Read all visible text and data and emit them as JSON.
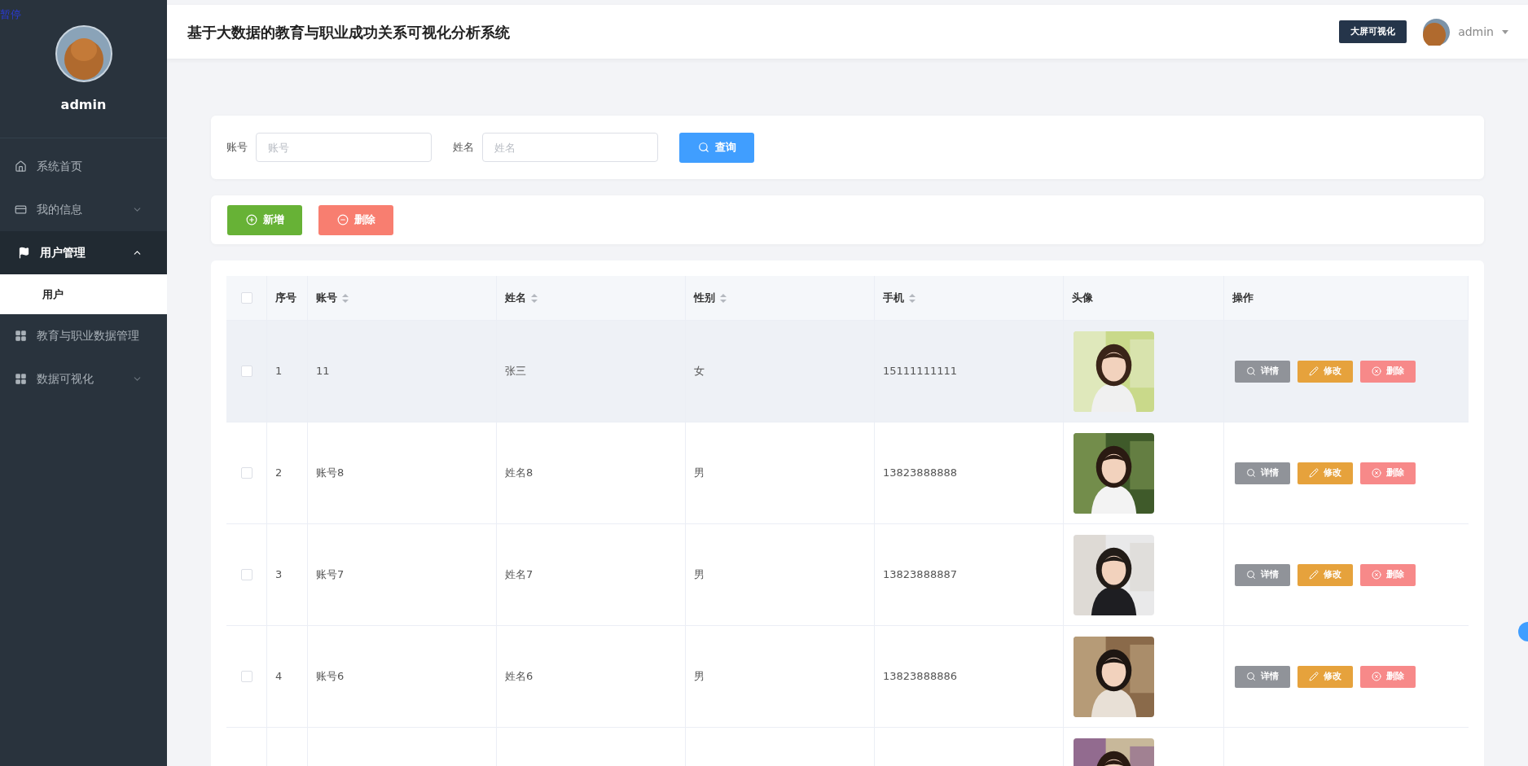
{
  "overlay_label": "暂停",
  "sidebar": {
    "user": "admin",
    "items": [
      {
        "label": "系统首页",
        "selected": false
      },
      {
        "label": "我的信息",
        "selected": false,
        "expanded": false
      },
      {
        "label": "用户管理",
        "selected": true,
        "expanded": true,
        "children": [
          {
            "label": "用户",
            "selected": true
          }
        ]
      },
      {
        "label": "教育与职业数据管理",
        "selected": false
      },
      {
        "label": "数据可视化",
        "selected": false,
        "expanded": false
      }
    ]
  },
  "header": {
    "title": "基于大数据的教育与职业成功关系可视化分析系统",
    "big_screen_button": "大屏可视化",
    "user": "admin"
  },
  "search": {
    "fields": [
      {
        "label": "账号",
        "placeholder": "账号"
      },
      {
        "label": "姓名",
        "placeholder": "姓名"
      }
    ],
    "button": "查询"
  },
  "actions": [
    {
      "label": "新增",
      "kind": "add"
    },
    {
      "label": "删除",
      "kind": "delete"
    }
  ],
  "table": {
    "select_all": false,
    "columns": [
      {
        "label": "序号",
        "sortable": false
      },
      {
        "label": "账号",
        "sortable": true
      },
      {
        "label": "姓名",
        "sortable": true
      },
      {
        "label": "性别",
        "sortable": true
      },
      {
        "label": "手机",
        "sortable": true
      },
      {
        "label": "头像",
        "sortable": false
      },
      {
        "label": "操作",
        "sortable": false
      }
    ],
    "rows": [
      {
        "checked": false,
        "highlighted": true,
        "cells": [
          "1",
          "11",
          "张三",
          "女",
          "15111111111"
        ],
        "actions": [
          {
            "label": "详情",
            "kind": "detail"
          },
          {
            "label": "修改",
            "kind": "edit"
          },
          {
            "label": "删除",
            "kind": "delete"
          }
        ]
      },
      {
        "checked": false,
        "highlighted": false,
        "cells": [
          "2",
          "账号8",
          "姓名8",
          "男",
          "13823888888"
        ],
        "actions": [
          {
            "label": "详情",
            "kind": "detail"
          },
          {
            "label": "修改",
            "kind": "edit"
          },
          {
            "label": "删除",
            "kind": "delete"
          }
        ]
      },
      {
        "checked": false,
        "highlighted": false,
        "cells": [
          "3",
          "账号7",
          "姓名7",
          "男",
          "13823888887"
        ],
        "actions": [
          {
            "label": "详情",
            "kind": "detail"
          },
          {
            "label": "修改",
            "kind": "edit"
          },
          {
            "label": "删除",
            "kind": "delete"
          }
        ]
      },
      {
        "checked": false,
        "highlighted": false,
        "cells": [
          "4",
          "账号6",
          "姓名6",
          "男",
          "13823888886"
        ],
        "actions": [
          {
            "label": "详情",
            "kind": "detail"
          },
          {
            "label": "修改",
            "kind": "edit"
          },
          {
            "label": "删除",
            "kind": "delete"
          }
        ]
      },
      {
        "highlighted": false
      }
    ]
  }
}
